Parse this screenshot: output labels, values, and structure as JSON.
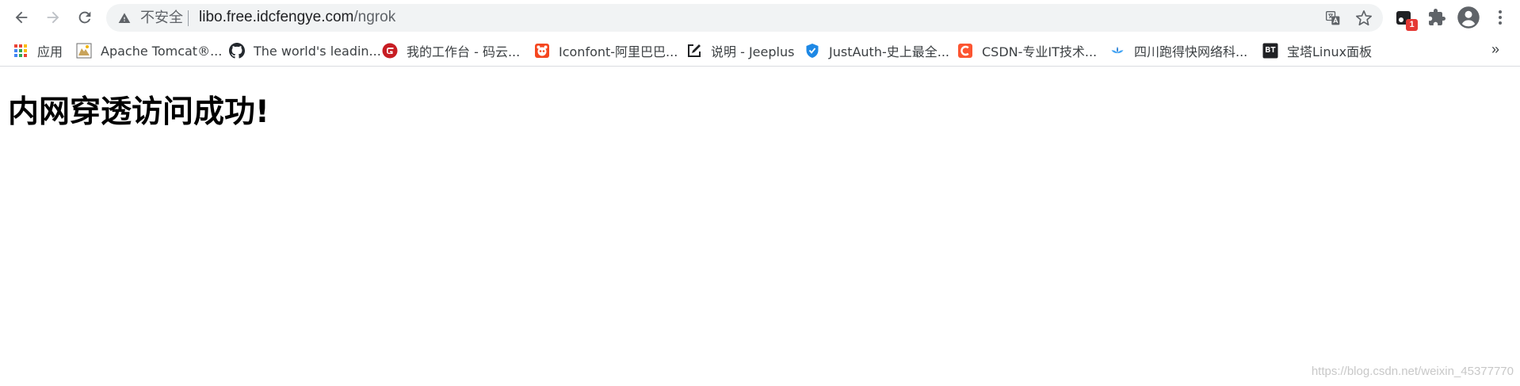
{
  "address_bar": {
    "security_label": "不安全",
    "url_host": "libo.free.idcfengye.com",
    "url_path": "/ngrok"
  },
  "extension": {
    "badge": "1"
  },
  "bookmarks": {
    "apps_label": "应用",
    "items": [
      {
        "label": "Apache Tomcat®..."
      },
      {
        "label": "The world's leadin..."
      },
      {
        "label": "我的工作台 - 码云..."
      },
      {
        "label": "Iconfont-阿里巴巴..."
      },
      {
        "label": "说明 - Jeeplus"
      },
      {
        "label": "JustAuth-史上最全..."
      },
      {
        "label": "CSDN-专业IT技术..."
      },
      {
        "label": "四川跑得快网络科..."
      },
      {
        "label": "宝塔Linux面板"
      }
    ],
    "overflow": "»"
  },
  "page": {
    "heading": "内网穿透访问成功!"
  },
  "watermark": "https://blog.csdn.net/weixin_45377770",
  "colors": {
    "omnibox_bg": "#f1f3f4",
    "toolbar_icon": "#5f6368",
    "badge_red": "#e53935",
    "gitee_red": "#c71d23",
    "iconfont_orange": "#f5461f",
    "csdn_orange": "#fc5531",
    "justauth_blue": "#1e88e5"
  },
  "icons": {
    "back": "back-arrow-icon",
    "forward": "forward-arrow-icon",
    "reload": "reload-icon",
    "warning": "warning-icon",
    "translate": "translate-icon",
    "bookmark_star": "star-icon",
    "extension": "extension-icon",
    "extensions_menu": "puzzle-icon",
    "profile": "profile-icon",
    "menu": "kebab-menu-icon"
  }
}
